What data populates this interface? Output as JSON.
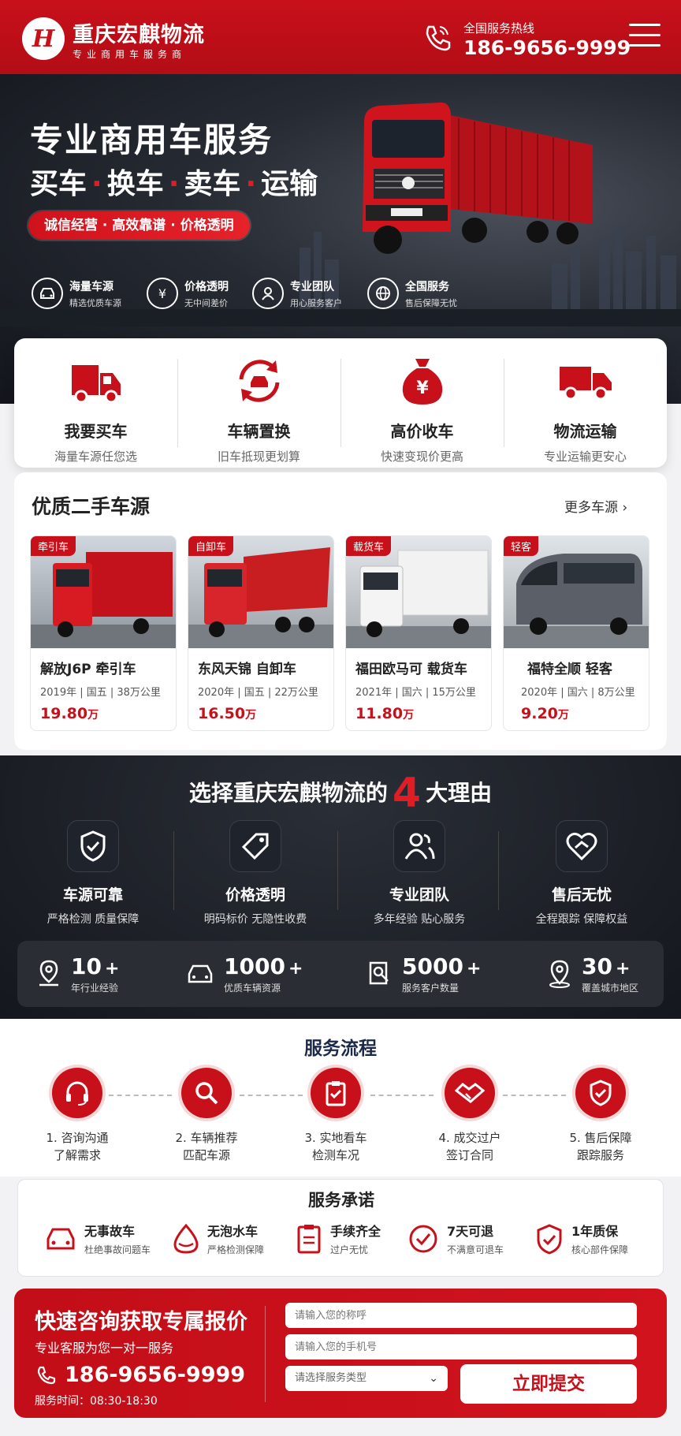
{
  "header": {
    "brand_name": "重庆宏麒物流",
    "brand_sub": "专业商用车服务商",
    "hotline_label": "全国服务热线",
    "hotline_number": "186-9656-9999"
  },
  "hero": {
    "title": "专业商用车服务",
    "slogan_items": [
      "买车",
      "换车",
      "卖车",
      "运输"
    ],
    "pill": "诚信经营 · 高效靠谱 · 价格透明",
    "features": [
      {
        "title": "海量车源",
        "sub": "精选优质车源",
        "icon": "car-icon"
      },
      {
        "title": "价格透明",
        "sub": "无中间差价",
        "icon": "price-tag-icon"
      },
      {
        "title": "专业团队",
        "sub": "用心服务客户",
        "icon": "user-icon"
      },
      {
        "title": "全国服务",
        "sub": "售后保障无忧",
        "icon": "globe-icon"
      }
    ]
  },
  "services": [
    {
      "title": "我要买车",
      "sub": "海量车源任您选",
      "icon": "truck-front-icon"
    },
    {
      "title": "车辆置换",
      "sub": "旧车抵现更划算",
      "icon": "exchange-car-icon"
    },
    {
      "title": "高价收车",
      "sub": "快速变现价更高",
      "icon": "money-bag-icon"
    },
    {
      "title": "物流运输",
      "sub": "专业运输更安心",
      "icon": "delivery-truck-icon"
    }
  ],
  "used_cars": {
    "title": "优质二手车源",
    "more": "更多车源",
    "items": [
      {
        "tag": "牵引车",
        "name": "解放J6P 牵引车",
        "meta": "2019年 | 国五 | 38万公里",
        "price": "19.80",
        "unit": "万"
      },
      {
        "tag": "自卸车",
        "name": "东风天锦 自卸车",
        "meta": "2020年 | 国五 | 22万公里",
        "price": "16.50",
        "unit": "万"
      },
      {
        "tag": "载货车",
        "name": "福田欧马可 载货车",
        "meta": "2021年 | 国六 | 15万公里",
        "price": "11.80",
        "unit": "万"
      },
      {
        "tag": "轻客",
        "name": "福特全顺 轻客",
        "meta": "2020年 | 国六 | 8万公里",
        "price": "9.20",
        "unit": "万"
      }
    ]
  },
  "reasons": {
    "title_pre": "选择重庆宏麒物流的",
    "title_num": "4",
    "title_post": "大理由",
    "items": [
      {
        "title": "车源可靠",
        "sub": "严格检测 质量保障",
        "icon": "shield-check-icon"
      },
      {
        "title": "价格透明",
        "sub": "明码标价 无隐性收费",
        "icon": "price-tag-icon"
      },
      {
        "title": "专业团队",
        "sub": "多年经验 贴心服务",
        "icon": "team-icon"
      },
      {
        "title": "售后无忧",
        "sub": "全程跟踪 保障权益",
        "icon": "heart-hand-icon"
      }
    ],
    "stats": [
      {
        "num": "10",
        "plus": "+",
        "label": "年行业经验",
        "icon": "location-person-icon"
      },
      {
        "num": "1000",
        "plus": "+",
        "label": "优质车辆资源",
        "icon": "car-icon"
      },
      {
        "num": "5000",
        "plus": "+",
        "label": "服务客户数量",
        "icon": "handshake-doc-icon"
      },
      {
        "num": "30",
        "plus": "+",
        "label": "覆盖城市地区",
        "icon": "map-pin-icon"
      }
    ]
  },
  "process": {
    "title": "服务流程",
    "steps": [
      {
        "l1": "1. 咨询沟通",
        "l2": "了解需求",
        "icon": "headset-icon"
      },
      {
        "l1": "2. 车辆推荐",
        "l2": "匹配车源",
        "icon": "search-icon"
      },
      {
        "l1": "3. 实地看车",
        "l2": "检测车况",
        "icon": "clipboard-icon"
      },
      {
        "l1": "4. 成交过户",
        "l2": "签订合同",
        "icon": "handshake-icon"
      },
      {
        "l1": "5. 售后保障",
        "l2": "跟踪服务",
        "icon": "shield-check-icon"
      }
    ]
  },
  "promise": {
    "title": "服务承诺",
    "items": [
      {
        "title": "无事故车",
        "sub": "杜绝事故问题车",
        "icon": "car-icon"
      },
      {
        "title": "无泡水车",
        "sub": "严格检测保障",
        "icon": "water-drop-icon"
      },
      {
        "title": "手续齐全",
        "sub": "过户无忧",
        "icon": "document-icon"
      },
      {
        "title": "7天可退",
        "sub": "不满意可退车",
        "icon": "check-circle-icon"
      },
      {
        "title": "1年质保",
        "sub": "核心部件保障",
        "icon": "shield-check-icon"
      }
    ]
  },
  "consult": {
    "title": "快速咨询获取专属报价",
    "sub": "专业客服为您一对一服务",
    "phone": "186-9656-9999",
    "hours": "服务时间：08:30-18:30",
    "name_placeholder": "请输入您的称呼",
    "phone_placeholder": "请输入您的手机号",
    "service_select": "请选择服务类型",
    "submit": "立即提交"
  },
  "colors": {
    "brand_red": "#c8101a",
    "dark_bg": "#14171d"
  }
}
